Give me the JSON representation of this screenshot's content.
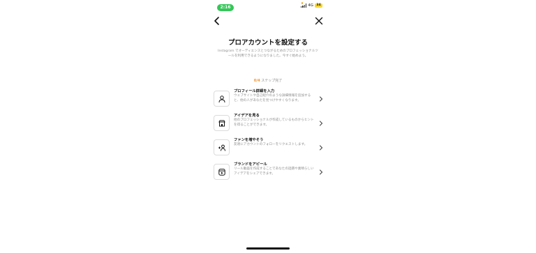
{
  "status_bar": {
    "time": "2:16",
    "network": "4G",
    "battery": "34"
  },
  "nav": {
    "back_icon": "chevron-left-icon",
    "close_icon": "close-icon"
  },
  "header": {
    "title": "プロアカウントを設定する",
    "description": "Instagram でオーディエンスとつながるためのプロフェッショナルツールを利用できるようになりました。今すぐ始めよう。"
  },
  "progress": {
    "count": "0/4",
    "label": "ステップ完了"
  },
  "steps": [
    {
      "icon": "person-icon",
      "title": "プロフィール詳細を入力",
      "description": "ウェブサイトや自己紹介のような詳細情報を追加すると、他の人があなたを見つけやすくなります。"
    },
    {
      "icon": "shop-icon",
      "title": "アイデアを見る",
      "description": "他のプロフェッショナルが作成しているものからヒントを得ることができます。"
    },
    {
      "icon": "add-person-icon",
      "title": "ファンを増やそう",
      "description": "友達にアカウントのフォローをリクエストします。"
    },
    {
      "icon": "reel-icon",
      "title": "ブランドをアピール",
      "description": "リール動画を作成することであなたの話題や素晴らしいアイデアをシェアできます。"
    }
  ],
  "colors": {
    "accent_orange": "#f09433",
    "status_green": "#35c759",
    "battery_yellow": "#f5d63b"
  }
}
